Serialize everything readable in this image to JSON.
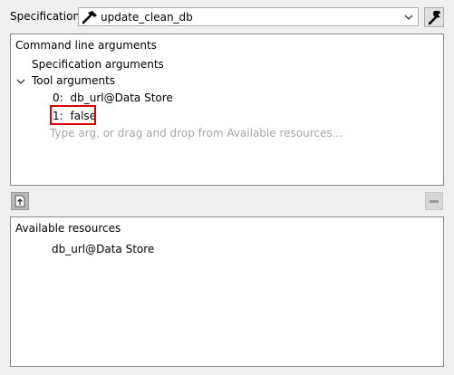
{
  "specification": {
    "label": "Specification:",
    "selected": "update_clean_db"
  },
  "command_line": {
    "title": "Command line arguments",
    "spec_args_label": "Specification arguments",
    "tool_args_label": "Tool arguments",
    "args": [
      {
        "index": "0:",
        "value": "db_url@Data Store"
      },
      {
        "index": "1:",
        "value": "false"
      }
    ],
    "placeholder": "Type arg, or drag and drop from Available resources..."
  },
  "available_resources": {
    "title": "Available resources",
    "items": [
      "db_url@Data Store"
    ]
  },
  "colors": {
    "highlight": "#e00000",
    "placeholder": "#a6a6a6"
  }
}
